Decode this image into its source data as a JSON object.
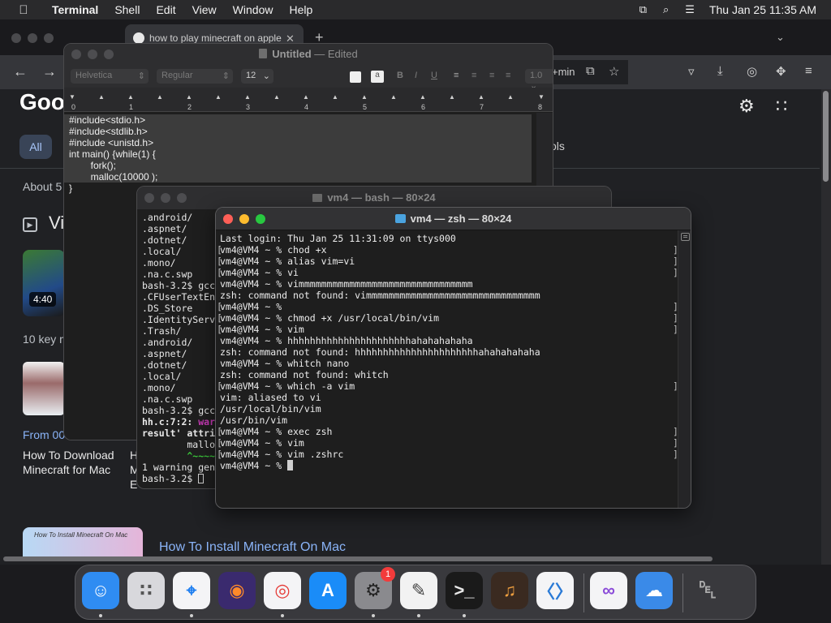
{
  "menubar": {
    "app_name": "Terminal",
    "items": [
      "Shell",
      "Edit",
      "View",
      "Window",
      "Help"
    ],
    "clock": "Thu Jan 25  11:35 AM"
  },
  "chrome": {
    "tab_title": "how to play minecraft on apple",
    "omnibox_fragment": "+min",
    "logo_fragment": "Goo",
    "all_tab": "All",
    "tools_tab_fragment": "ols",
    "about_fragment": "About 5",
    "videos_fragment": "Vi",
    "video_duration": "4:40",
    "key_moments_fragment": "10 key m",
    "from_fragment": "From 00",
    "result1_title": "How To Download Minecraft for Mac",
    "result2_fragment_lines": [
      "H",
      "M",
      "E"
    ],
    "thumb3_caption": "How To Install Minecraft On Mac",
    "result_link": "How To Install Minecraft On Mac"
  },
  "textedit": {
    "title": "Untitled",
    "title_suffix": "— Edited",
    "font_family": "Helvetica",
    "font_style": "Regular",
    "font_size": "12",
    "line_spacing": "1.0",
    "ruler_numbers": [
      "0",
      "1",
      "2",
      "3",
      "4",
      "5",
      "6",
      "7",
      "8"
    ],
    "document_lines": [
      "#include<stdio.h>",
      "#include<stdlib.h>",
      "#include <unistd.h>",
      "",
      "int main() {while(1) {",
      "        fork();",
      "        malloc(10000 );",
      "}"
    ]
  },
  "terminal_bash": {
    "title": "vm4 — bash — 80×24",
    "lines": [
      ".android/",
      ".aspnet/",
      ".dotnet/",
      ".local/",
      ".mono/",
      ".na.c.swp",
      "bash-3.2$ gcc",
      ".CFUserTextEn",
      ".DS_Store",
      ".IdentityServ",
      ".Trash/",
      ".android/",
      ".aspnet/",
      ".dotnet/",
      ".local/",
      ".mono/",
      ".na.c.swp"
    ],
    "gcc_prompt": "bash-3.2$ gcc",
    "warn_file": "hh.c:7:2:",
    "warn_word": "war",
    "result_attr": "result' attri",
    "malloc_frag": "        mallo",
    "caret_frag": "        ^~~~~",
    "warning_summary": "1 warning gen",
    "final_prompt": "bash-3.2$ "
  },
  "terminal_zsh": {
    "title": "vm4 — zsh — 80×24",
    "lines": [
      {
        "text": "Last login: Thu Jan 25 11:31:09 on ttys000",
        "bracket": false
      },
      {
        "text": "vm4@VM4 ~ % chod +x",
        "bracket": true
      },
      {
        "text": "vm4@VM4 ~ % alias vim=vi",
        "bracket": true
      },
      {
        "text": "vm4@VM4 ~ % vi",
        "bracket": true
      },
      {
        "text": "vm4@VM4 ~ % vimmmmmmmmmmmmmmmmmmmmmmmmmmmmmmm",
        "bracket": false
      },
      {
        "text": "zsh: command not found: vimmmmmmmmmmmmmmmmmmmmmmmmmmmmmmm",
        "bracket": false
      },
      {
        "text": "vm4@VM4 ~ %",
        "bracket": true
      },
      {
        "text": "vm4@VM4 ~ % chmod +x /usr/local/bin/vim",
        "bracket": true
      },
      {
        "text": "vm4@VM4 ~ % vim",
        "bracket": true
      },
      {
        "text": "vm4@VM4 ~ % hhhhhhhhhhhhhhhhhhhhhhahahahahaha",
        "bracket": false
      },
      {
        "text": "zsh: command not found: hhhhhhhhhhhhhhhhhhhhhhahahahahaha",
        "bracket": false
      },
      {
        "text": "vm4@VM4 ~ % whitch nano",
        "bracket": false
      },
      {
        "text": "zsh: command not found: whitch",
        "bracket": false
      },
      {
        "text": "vm4@VM4 ~ % which -a vim",
        "bracket": true
      },
      {
        "text": "vim: aliased to vi",
        "bracket": false
      },
      {
        "text": "/usr/local/bin/vim",
        "bracket": false
      },
      {
        "text": "/usr/bin/vim",
        "bracket": false
      },
      {
        "text": "vm4@VM4 ~ % exec zsh",
        "bracket": true
      },
      {
        "text": "vm4@VM4 ~ % vim",
        "bracket": true
      },
      {
        "text": "vm4@VM4 ~ % vim .zshrc",
        "bracket": true
      }
    ],
    "prompt": "vm4@VM4 ~ % "
  },
  "dock": {
    "apps": [
      {
        "name": "finder-icon",
        "bg": "#2f8cf2"
      },
      {
        "name": "launchpad-icon",
        "bg": "#d8d8dc"
      },
      {
        "name": "safari-icon",
        "bg": "#f4f4f6"
      },
      {
        "name": "firefox-icon",
        "bg": "#3a2a6e"
      },
      {
        "name": "chrome-icon",
        "bg": "#f4f4f6"
      },
      {
        "name": "app-store-icon",
        "bg": "#1a8cf8"
      },
      {
        "name": "system-settings-icon",
        "bg": "#8a8a8e"
      },
      {
        "name": "textedit-icon",
        "bg": "#f2f2f2"
      },
      {
        "name": "terminal-icon",
        "bg": "#1a1a1a"
      },
      {
        "name": "garageband-icon",
        "bg": "#3a2a20"
      },
      {
        "name": "vscode-icon",
        "bg": "#f4f4f6"
      },
      {
        "name": "visual-studio-icon",
        "bg": "#f4f4f6"
      },
      {
        "name": "weather-icon",
        "bg": "#3a8ae8"
      },
      {
        "name": "trash-icon",
        "bg": "transparent"
      }
    ],
    "settings_badge": "1"
  }
}
